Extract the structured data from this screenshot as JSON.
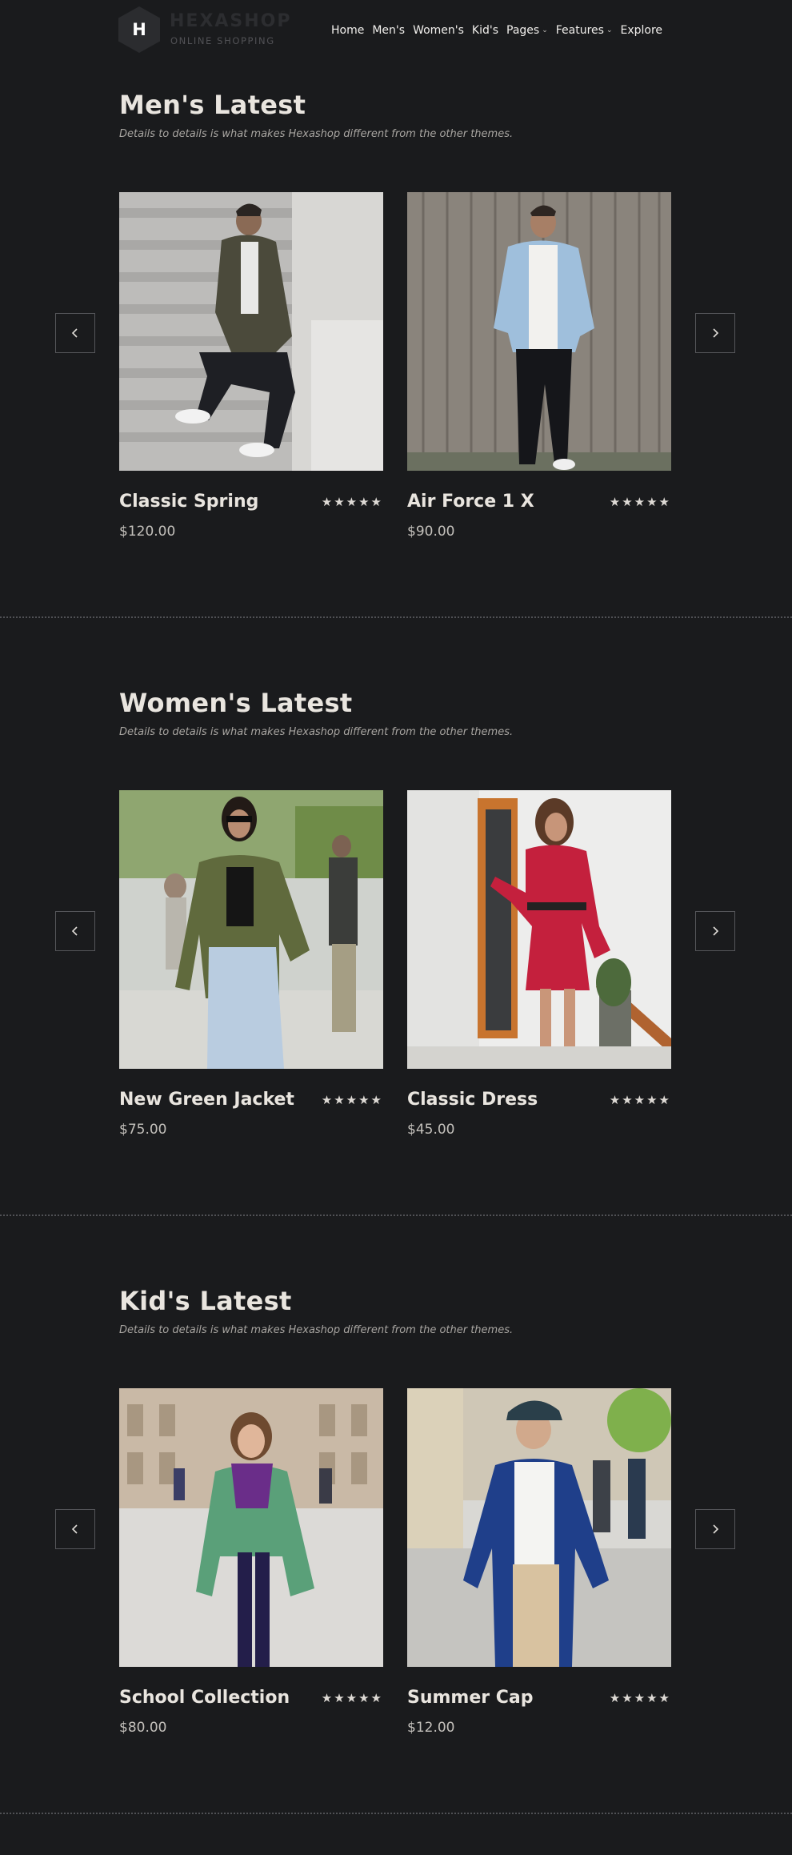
{
  "brand": {
    "logo_letter": "H",
    "name": "HEXASHOP",
    "tagline": "ONLINE SHOPPING"
  },
  "nav": {
    "items": [
      {
        "label": "Home"
      },
      {
        "label": "Men's"
      },
      {
        "label": "Women's"
      },
      {
        "label": "Kid's"
      },
      {
        "label": "Pages",
        "dropdown": true
      },
      {
        "label": "Features",
        "dropdown": true
      },
      {
        "label": "Explore"
      }
    ]
  },
  "sections": [
    {
      "title": "Men's Latest",
      "subtitle": "Details to details is what makes Hexashop different from the other themes.",
      "products": [
        {
          "name": "Classic Spring",
          "price": "$120.00",
          "rating": 5,
          "stars": "★★★★★"
        },
        {
          "name": "Air Force 1 X",
          "price": "$90.00",
          "rating": 5,
          "stars": "★★★★★"
        }
      ]
    },
    {
      "title": "Women's Latest",
      "subtitle": "Details to details is what makes Hexashop different from the other themes.",
      "products": [
        {
          "name": "New Green Jacket",
          "price": "$75.00",
          "rating": 5,
          "stars": "★★★★★"
        },
        {
          "name": "Classic Dress",
          "price": "$45.00",
          "rating": 5,
          "stars": "★★★★★"
        }
      ]
    },
    {
      "title": "Kid's Latest",
      "subtitle": "Details to details is what makes Hexashop different from the other themes.",
      "products": [
        {
          "name": "School Collection",
          "price": "$80.00",
          "rating": 5,
          "stars": "★★★★★"
        },
        {
          "name": "Summer Cap",
          "price": "$12.00",
          "rating": 5,
          "stars": "★★★★★"
        }
      ]
    }
  ],
  "icons": {
    "prev": "chevron-left-icon",
    "next": "chevron-right-icon",
    "rating": "star-icon"
  },
  "colors": {
    "background": "#1a1b1d",
    "heading": "#e9e5df",
    "border": "#55565a"
  }
}
